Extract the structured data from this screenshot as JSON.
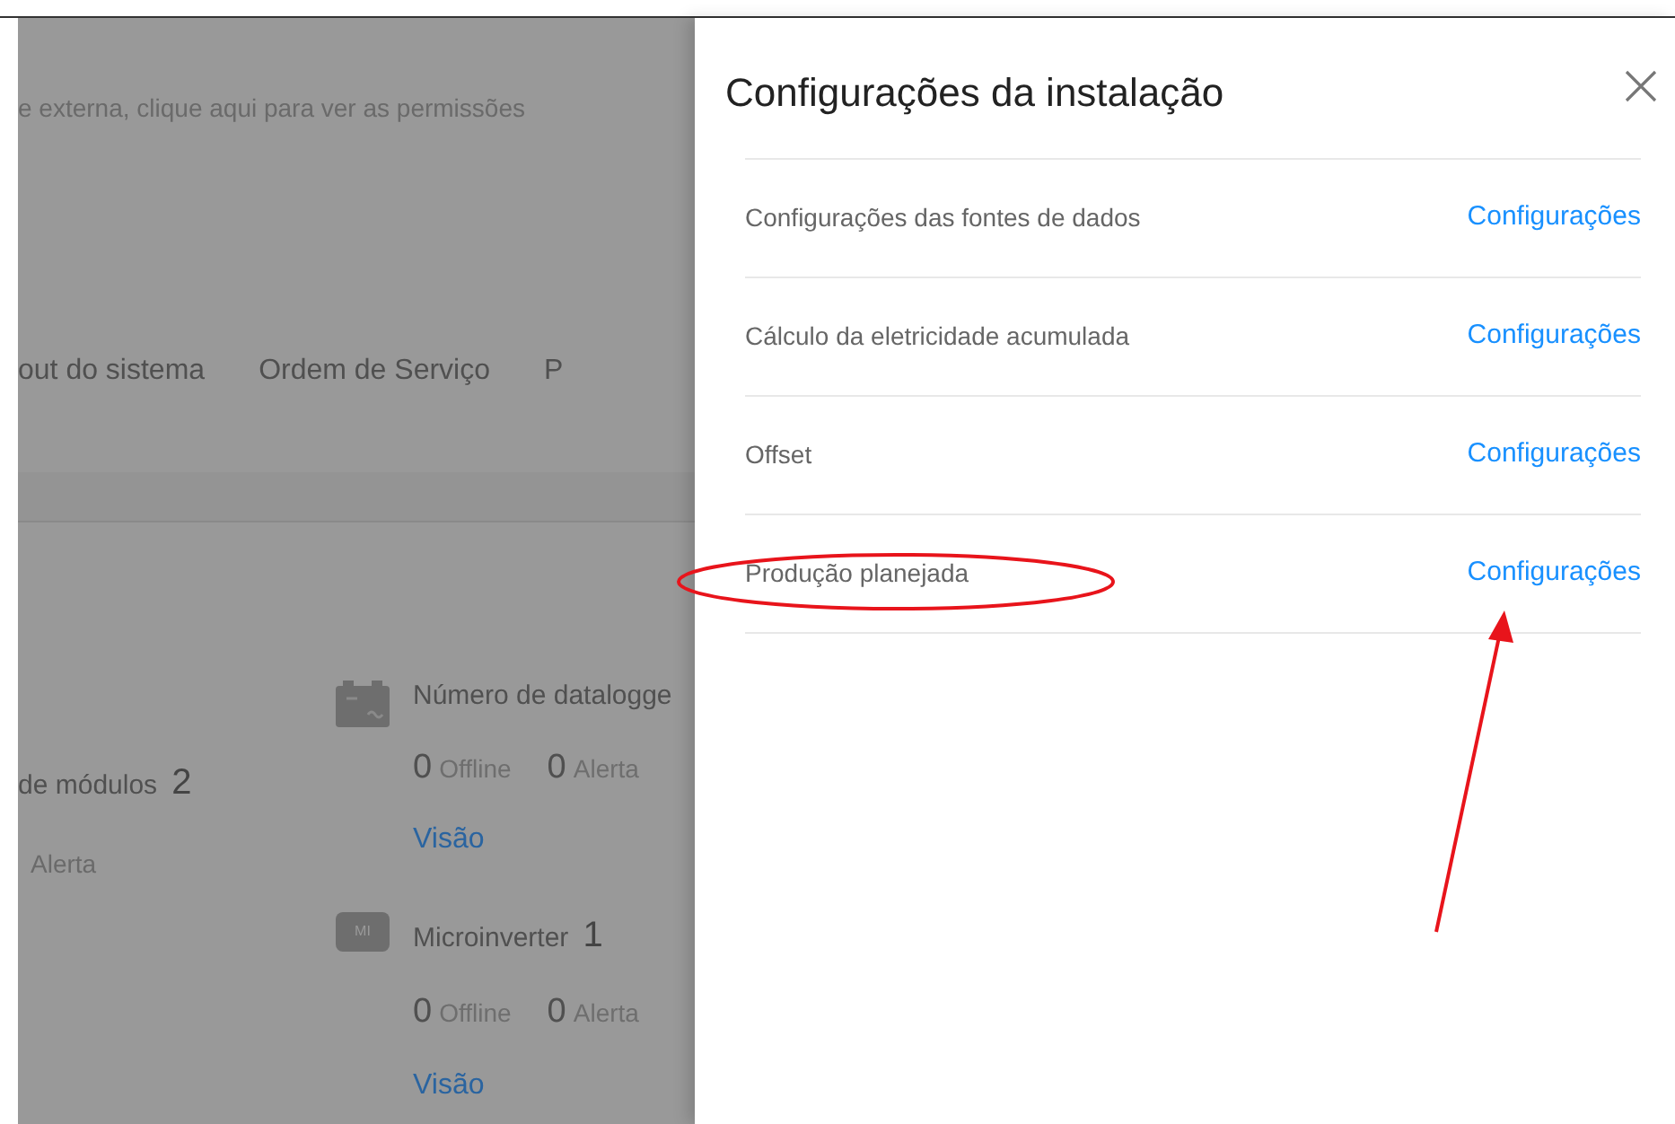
{
  "background": {
    "notice": "e externa, clique aqui para ver as permissões",
    "nav": [
      "out do sistema",
      "Ordem de Serviço",
      "P"
    ],
    "modules": {
      "label": "de módulos",
      "count": "2",
      "alert_label": "Alerta"
    },
    "devices": [
      {
        "kind": "datalogger",
        "label": "Número de datalogge",
        "offline": "0",
        "offline_label": "Offline",
        "alert": "0",
        "alert_label": "Alerta",
        "link": "Visão"
      },
      {
        "kind": "microinverter",
        "icon_label": "MI",
        "label": "Microinverter",
        "count": "1",
        "offline": "0",
        "offline_label": "Offline",
        "alert": "0",
        "alert_label": "Alerta",
        "link": "Visão"
      }
    ]
  },
  "drawer": {
    "title": "Configurações da instalação",
    "rows": [
      {
        "label": "Configurações das fontes de dados",
        "link": "Configurações"
      },
      {
        "label": "Cálculo da eletricidade acumulada",
        "link": "Configurações"
      },
      {
        "label": "Offset",
        "link": "Configurações"
      },
      {
        "label": "Produção planejada",
        "link": "Configurações"
      }
    ]
  }
}
